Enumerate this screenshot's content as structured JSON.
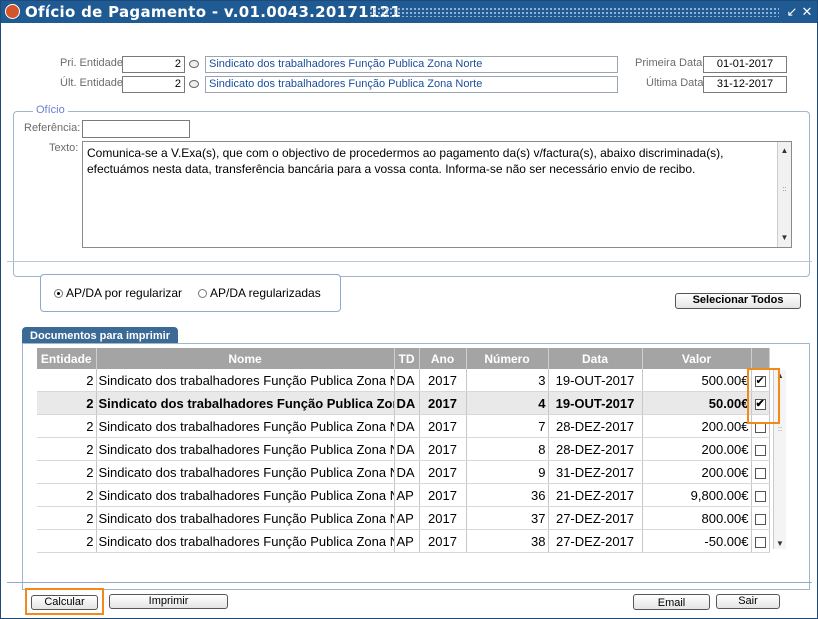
{
  "window": {
    "title": "Ofício de Pagamento - v.01.0043.20171121"
  },
  "header": {
    "pri_entidade_label": "Pri. Entidade",
    "pri_entidade_value": "2",
    "pri_entidade_name": "Sindicato dos trabalhadores Função Publica Zona Norte",
    "ult_entidade_label": "Últ. Entidade",
    "ult_entidade_value": "2",
    "ult_entidade_name": "Sindicato dos trabalhadores Função Publica Zona Norte",
    "primeira_data_label": "Primeira Data:",
    "primeira_data_value": "01-01-2017",
    "ultima_data_label": "Última Data:",
    "ultima_data_value": "31-12-2017"
  },
  "oficio": {
    "legend": "Ofício",
    "referencia_label": "Referência:",
    "referencia_value": "",
    "texto_label": "Texto:",
    "texto_value": "Comunica-se a V.Exa(s), que com o objectivo de procedermos ao pagamento da(s) v/factura(s), abaixo discriminada(s), efectuámos nesta data, transferência bancária para a vossa conta. Informa-se não ser necessário envio de recibo."
  },
  "filter": {
    "option1": "AP/DA por regularizar",
    "option2": "AP/DA regularizadas",
    "selected": "AP/DA por regularizar",
    "select_all_label": "Selecionar Todos"
  },
  "documents": {
    "tab_label": "Documentos para imprimir",
    "columns": [
      "Entidade",
      "Nome",
      "TD",
      "Ano",
      "Número",
      "Data",
      "Valor"
    ],
    "rows": [
      {
        "entidade": "2",
        "nome": "Sindicato dos trabalhadores Função Publica Zona Norte",
        "td": "DA",
        "ano": "2017",
        "numero": "3",
        "data": "19-OUT-2017",
        "valor": "500.00€",
        "checked": true,
        "selected": false
      },
      {
        "entidade": "2",
        "nome": "Sindicato dos trabalhadores Função Publica Zona Norte",
        "td": "DA",
        "ano": "2017",
        "numero": "4",
        "data": "19-OUT-2017",
        "valor": "50.00€",
        "checked": true,
        "selected": true
      },
      {
        "entidade": "2",
        "nome": "Sindicato dos trabalhadores Função Publica Zona Norte",
        "td": "DA",
        "ano": "2017",
        "numero": "7",
        "data": "28-DEZ-2017",
        "valor": "200.00€",
        "checked": false,
        "selected": false
      },
      {
        "entidade": "2",
        "nome": "Sindicato dos trabalhadores Função Publica Zona Norte",
        "td": "DA",
        "ano": "2017",
        "numero": "8",
        "data": "28-DEZ-2017",
        "valor": "200.00€",
        "checked": false,
        "selected": false
      },
      {
        "entidade": "2",
        "nome": "Sindicato dos trabalhadores Função Publica Zona Norte",
        "td": "DA",
        "ano": "2017",
        "numero": "9",
        "data": "31-DEZ-2017",
        "valor": "200.00€",
        "checked": false,
        "selected": false
      },
      {
        "entidade": "2",
        "nome": "Sindicato dos trabalhadores Função Publica Zona Norte",
        "td": "AP",
        "ano": "2017",
        "numero": "36",
        "data": "21-DEZ-2017",
        "valor": "9,800.00€",
        "checked": false,
        "selected": false
      },
      {
        "entidade": "2",
        "nome": "Sindicato dos trabalhadores Função Publica Zona Norte",
        "td": "AP",
        "ano": "2017",
        "numero": "37",
        "data": "27-DEZ-2017",
        "valor": "800.00€",
        "checked": false,
        "selected": false
      },
      {
        "entidade": "2",
        "nome": "Sindicato dos trabalhadores Função Publica Zona Norte",
        "td": "AP",
        "ano": "2017",
        "numero": "38",
        "data": "27-DEZ-2017",
        "valor": "-50.00€",
        "checked": false,
        "selected": false
      }
    ]
  },
  "footer": {
    "calcular_label": "Calcular",
    "imprimir_label": "Imprimir",
    "email_label": "Email",
    "sair_label": "Sair"
  },
  "colors": {
    "title_bar": "#1f5a93",
    "grid_header": "#a4a4a4",
    "highlight": "#f08a1c",
    "link_text": "#1a4e9a"
  }
}
